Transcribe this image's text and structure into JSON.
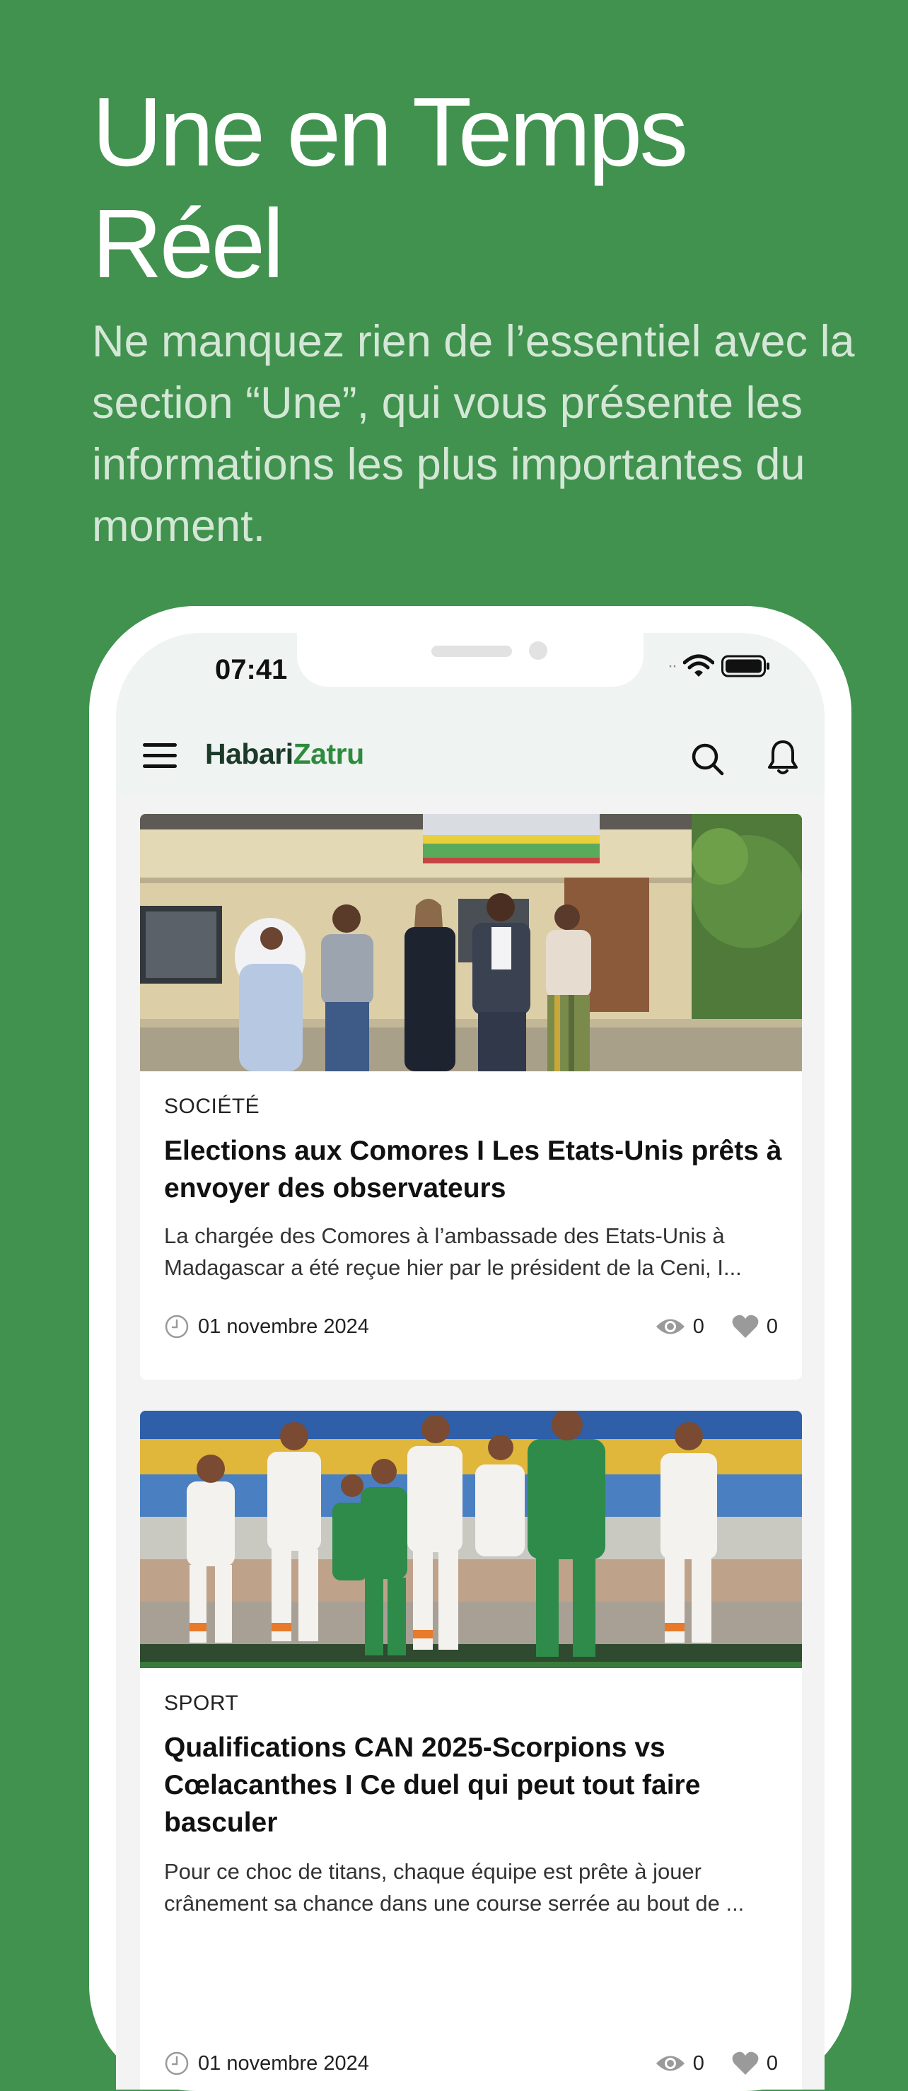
{
  "hero": {
    "title_line1": "Une en Temps",
    "title_line2": "Réel",
    "subtitle": "Ne manquez rien de l’essentiel avec la section “Une”, qui vous présente les informations les plus importantes du moment."
  },
  "status_bar": {
    "time": "07:41"
  },
  "app": {
    "logo_part1": "Habari",
    "logo_part2": "Zatru"
  },
  "colors": {
    "background": "#40924E",
    "logo_dark": "#1B3A2A",
    "logo_green": "#2E8B3E"
  },
  "articles": [
    {
      "category": "SOCIÉTÉ",
      "title": "Elections aux Comores I Les Etats-Unis prêts à envoyer des observateurs",
      "excerpt": "La chargée des Comores à l’ambassade des Etats-Unis à Madagascar a été reçue hier par le président de la Ceni, I...",
      "date": "01 novembre 2024",
      "views": "0",
      "likes": "0"
    },
    {
      "category": "SPORT",
      "title": "Qualifications CAN 2025-Scorpions vs Cœlacanthes I Ce duel qui peut tout faire basculer",
      "excerpt": "Pour ce choc de titans, chaque équipe est prête à jouer crânement sa chance dans une course serrée au bout de ...",
      "date": "01 novembre 2024",
      "views": "0",
      "likes": "0"
    }
  ],
  "icons": [
    "menu-icon",
    "search-icon",
    "bell-icon",
    "clock-icon",
    "eye-icon",
    "heart-icon",
    "wifi-icon",
    "battery-icon"
  ]
}
